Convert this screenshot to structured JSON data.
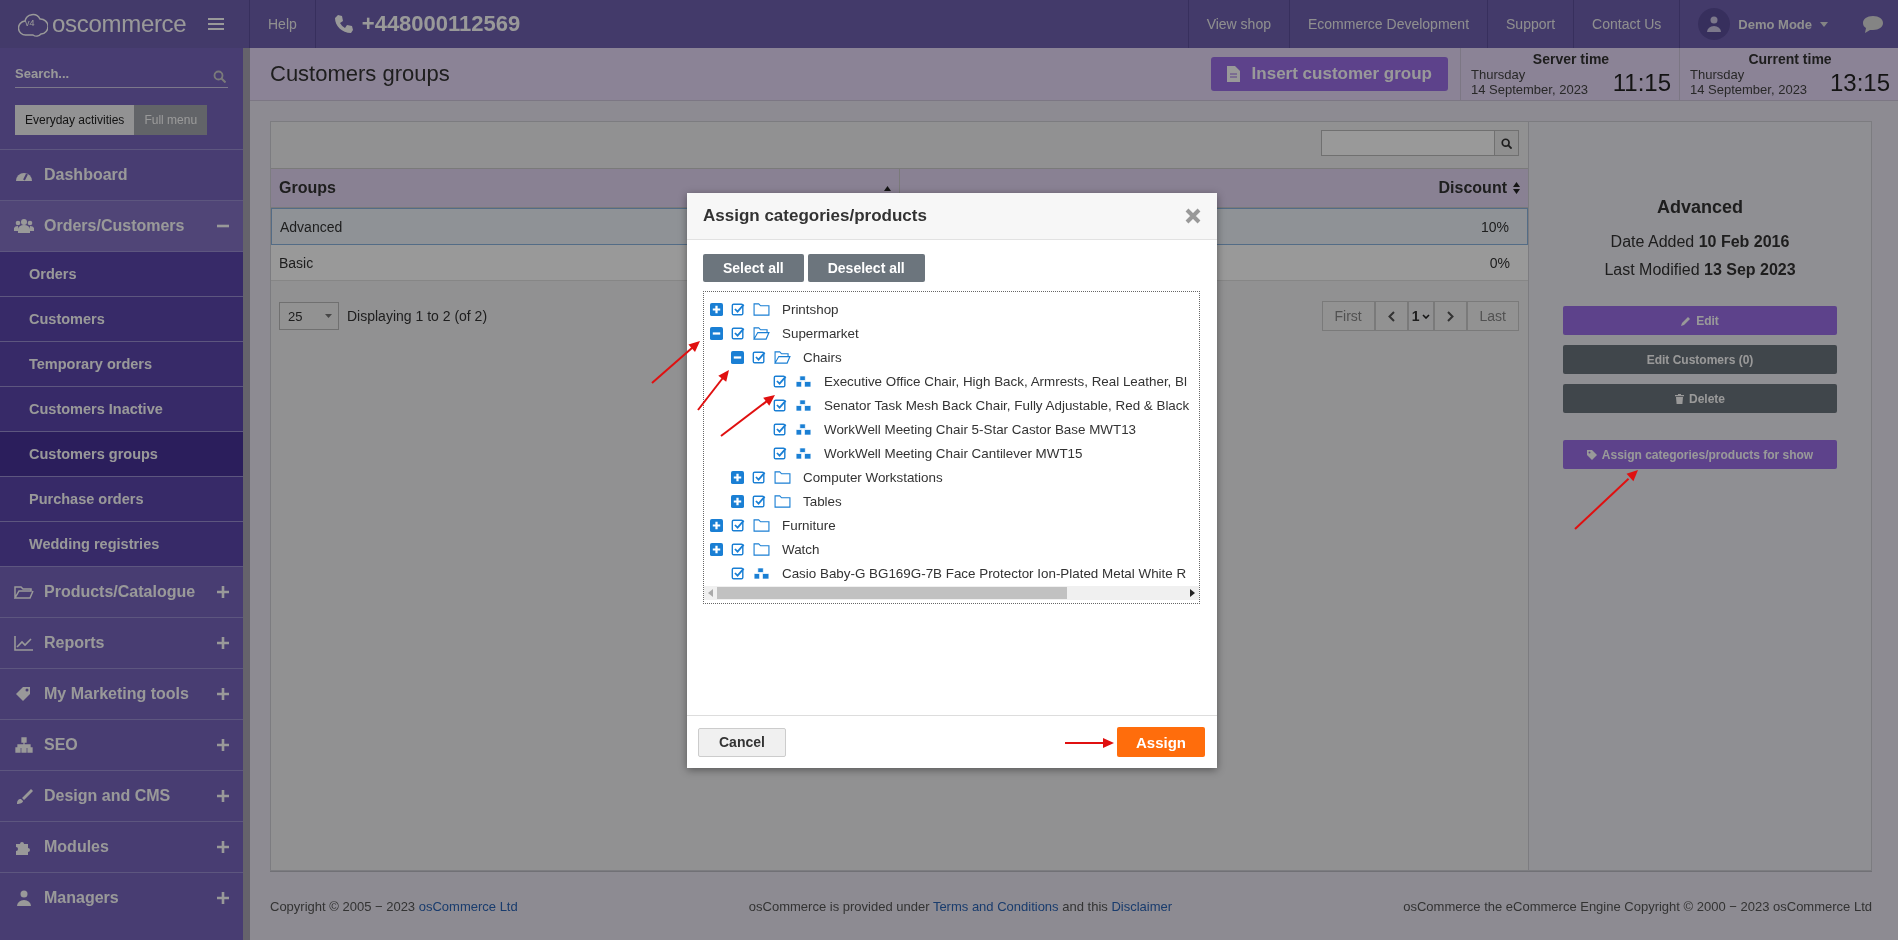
{
  "topbar": {
    "logo_badge": "v4",
    "logo": "oscommerce",
    "help": "Help",
    "phone": "+448000112569",
    "links": [
      "View shop",
      "Ecommerce Development",
      "Support",
      "Contact Us"
    ],
    "user": "Demo Mode"
  },
  "sidebar": {
    "search": {
      "placeholder": "Search..."
    },
    "modes": [
      {
        "label": "Everyday activities",
        "selected": true
      },
      {
        "label": "Full menu",
        "selected": false
      }
    ],
    "items": [
      {
        "label": "Dashboard",
        "kind": "link"
      },
      {
        "label": "Orders/Customers",
        "kind": "section",
        "expanded": true,
        "children": [
          {
            "label": "Orders",
            "selected": false
          },
          {
            "label": "Customers",
            "selected": false
          },
          {
            "label": "Temporary orders",
            "selected": false
          },
          {
            "label": "Customers Inactive",
            "selected": false
          },
          {
            "label": "Customers groups",
            "selected": true
          },
          {
            "label": "Purchase orders",
            "selected": false
          },
          {
            "label": "Wedding registries",
            "selected": false
          }
        ]
      },
      {
        "label": "Products/Catalogue",
        "kind": "section",
        "expanded": false
      },
      {
        "label": "Reports",
        "kind": "section",
        "expanded": false
      },
      {
        "label": "My Marketing tools",
        "kind": "section",
        "expanded": false
      },
      {
        "label": "SEO",
        "kind": "section",
        "expanded": false
      },
      {
        "label": "Design and CMS",
        "kind": "section",
        "expanded": false
      },
      {
        "label": "Modules",
        "kind": "section",
        "expanded": false
      },
      {
        "label": "Managers",
        "kind": "section",
        "expanded": false
      }
    ]
  },
  "page": {
    "title": "Customers groups",
    "insert_button": "Insert customer group",
    "clocks": [
      {
        "label": "Server time",
        "day": "Thursday",
        "date": "14 September, 2023",
        "time": "11:15"
      },
      {
        "label": "Current time",
        "day": "Thursday",
        "date": "14 September, 2023",
        "time": "13:15"
      }
    ]
  },
  "table": {
    "columns": [
      {
        "label": "Groups",
        "sorted": true
      },
      {
        "label": "Discount",
        "sorted": false
      }
    ],
    "rows": [
      {
        "group": "Advanced",
        "discount": "10%",
        "selected": true
      },
      {
        "group": "Basic",
        "discount": "0%",
        "selected": false
      }
    ],
    "per_page": "25",
    "display": "Displaying 1 to 2 (of 2)",
    "pager": {
      "first": "First",
      "page": "1",
      "last": "Last"
    }
  },
  "details": {
    "title": "Advanced",
    "fields": [
      {
        "label": "Date Added",
        "value": "10 Feb 2016"
      },
      {
        "label": "Last Modified",
        "value": "13 Sep 2023"
      }
    ],
    "buttons": [
      {
        "label": "Edit",
        "kind": "edit"
      },
      {
        "label": "Edit Customers (0)",
        "kind": "plain"
      },
      {
        "label": "Delete",
        "kind": "delete"
      },
      {
        "label": "Assign categories/products for show",
        "kind": "assign"
      }
    ]
  },
  "footer": {
    "left": {
      "text": "Copyright © 2005 − 2023",
      "link": "osCommerce Ltd"
    },
    "middle": [
      {
        "text": "osCommerce is provided under"
      },
      {
        "link": "Terms and Conditions"
      },
      {
        "text": "and this"
      },
      {
        "link": "Disclaimer"
      }
    ],
    "right": "osCommerce the eCommerce Engine Copyright © 2000 − 2023 osCommerce Ltd"
  },
  "modal": {
    "title": "Assign categories/products",
    "select_all": "Select all",
    "deselect_all": "Deselect all",
    "tree": [
      {
        "label": "Printshop",
        "kind": "folder",
        "expanded": false,
        "checked": true
      },
      {
        "label": "Supermarket",
        "kind": "folder",
        "expanded": true,
        "checked": true,
        "children": [
          {
            "label": "Chairs",
            "kind": "folder",
            "expanded": true,
            "checked": true,
            "children": [
              {
                "label": "Executive Office Chair, High Back, Armrests, Real Leather, Bl",
                "kind": "product",
                "checked": true
              },
              {
                "label": "Senator Task Mesh Back Chair, Fully Adjustable, Red & Black",
                "kind": "product",
                "checked": true
              },
              {
                "label": "WorkWell Meeting Chair 5-Star Castor Base MWT13",
                "kind": "product",
                "checked": true
              },
              {
                "label": "WorkWell Meeting Chair Cantilever MWT15",
                "kind": "product",
                "checked": true
              }
            ]
          },
          {
            "label": "Computer Workstations",
            "kind": "folder",
            "expanded": false,
            "checked": true
          },
          {
            "label": "Tables",
            "kind": "folder",
            "expanded": false,
            "checked": true
          }
        ]
      },
      {
        "label": "Furniture",
        "kind": "folder",
        "expanded": false,
        "checked": true
      },
      {
        "label": "Watch",
        "kind": "folder",
        "expanded": false,
        "checked": true
      },
      {
        "label": "Casio Baby-G BG169G-7B Face Protector Ion-Plated Metal White R",
        "kind": "product",
        "checked": true
      }
    ],
    "cancel": "Cancel",
    "assign": "Assign"
  }
}
